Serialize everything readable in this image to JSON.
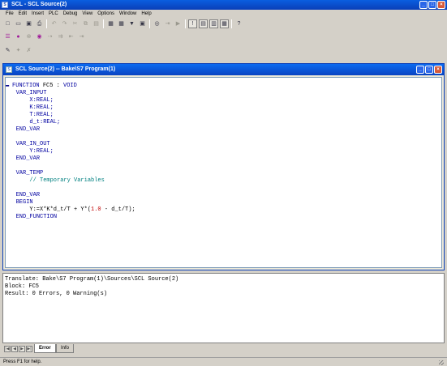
{
  "window": {
    "title": "SCL - SCL Source(2)",
    "app_icon": "scl-app-icon"
  },
  "menu": [
    "File",
    "Edit",
    "Insert",
    "PLC",
    "Debug",
    "View",
    "Options",
    "Window",
    "Help"
  ],
  "toolbar1": [
    {
      "icon": "new-file-icon",
      "glyph": "□"
    },
    {
      "icon": "open-icon",
      "glyph": "▭"
    },
    {
      "icon": "save-icon",
      "glyph": "▣"
    },
    {
      "icon": "print-icon",
      "glyph": "⎙"
    },
    {
      "icon": "undo-icon",
      "glyph": "↶"
    },
    {
      "icon": "redo-icon",
      "glyph": "↷"
    },
    {
      "icon": "cut-icon",
      "glyph": "✂"
    },
    {
      "icon": "copy-icon",
      "glyph": "⧉"
    },
    {
      "icon": "paste-icon",
      "glyph": "▤"
    },
    {
      "icon": "compile-icon",
      "glyph": "▦"
    },
    {
      "icon": "compile-all-icon",
      "glyph": "▦"
    },
    {
      "icon": "download-icon",
      "glyph": "▼"
    },
    {
      "icon": "monitor-icon",
      "glyph": "▣"
    },
    {
      "icon": "breakpoint-icon",
      "glyph": "◎"
    },
    {
      "icon": "step-icon",
      "glyph": "⇥"
    },
    {
      "icon": "run-icon",
      "glyph": "▶"
    },
    {
      "icon": "exclamation-icon",
      "glyph": "!"
    },
    {
      "icon": "cascade-icon",
      "glyph": "▤"
    },
    {
      "icon": "tile-icon",
      "glyph": "▥"
    },
    {
      "icon": "arrange-icon",
      "glyph": "▦"
    },
    {
      "icon": "context-help-icon",
      "glyph": "?"
    }
  ],
  "toolbar2": [
    {
      "icon": "list-icon",
      "glyph": "☰"
    },
    {
      "icon": "breakpoint-dot-icon",
      "glyph": "●"
    },
    {
      "icon": "delete-breakpoint-icon",
      "glyph": "⊗"
    },
    {
      "icon": "breakpoints-active-icon",
      "glyph": "◉"
    },
    {
      "icon": "step-into-icon",
      "glyph": "⇢"
    },
    {
      "icon": "step-over-icon",
      "glyph": "⇉"
    },
    {
      "icon": "step-out-icon",
      "glyph": "⇤"
    },
    {
      "icon": "resume-icon",
      "glyph": "⇥"
    }
  ],
  "toolbar3": [
    {
      "icon": "pen-icon",
      "glyph": "✎"
    },
    {
      "icon": "tool-icon",
      "glyph": "✦"
    },
    {
      "icon": "wrench-icon",
      "glyph": "✗"
    }
  ],
  "child_window": {
    "title": "SCL Source(2) -- Bake\\S7 Program(1)"
  },
  "code": {
    "function_kw": "FUNCTION",
    "function_name": "FC5",
    "function_sep": ":",
    "function_type": "VOID",
    "var_input": "VAR_INPUT",
    "in_x": "X:REAL;",
    "in_k": "K:REAL;",
    "in_t": "T:REAL;",
    "in_dt": "d_t:REAL;",
    "end_var_1": "END_VAR",
    "var_in_out": "VAR_IN_OUT",
    "io_y": "Y:REAL;",
    "end_var_2": "END_VAR",
    "var_temp": "VAR_TEMP",
    "temp_comment": "// Temporary Variables",
    "end_var_3": "END_VAR",
    "begin": "BEGIN",
    "stmt_a": "Y:=X*K*d_t/T + Y*(",
    "stmt_num": "1.0",
    "stmt_b": " - d_t/T);",
    "end_function": "END_FUNCTION"
  },
  "output": {
    "line1": "Translate: Bake\\S7 Program(1)\\Sources\\SCL Source(2)",
    "line2": "Block: FC5",
    "line3": "Result: 0 Errors, 0 Warning(s)"
  },
  "tabs": [
    "Error",
    "Info"
  ],
  "statusbar": {
    "text": "Press F1 for help."
  }
}
